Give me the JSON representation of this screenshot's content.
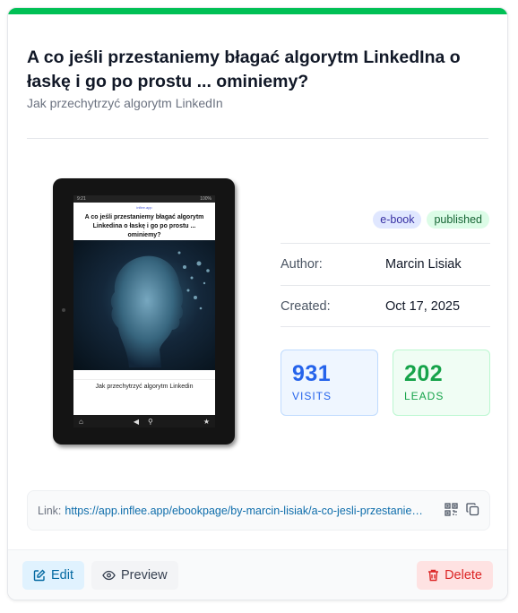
{
  "card": {
    "title": "A co jeśli przestaniemy błagać algorytm LinkedIna o łaskę i go po prostu ... ominiemy?",
    "subtitle": "Jak przechytrzyć algorytm LinkedIn",
    "accent_color": "#00c055"
  },
  "cover": {
    "status_time": "9:21",
    "status_battery": "100%",
    "logo_text": "inflee.app",
    "title": "A co jeśli przestaniemy błagać algorytm Linkedina o łaskę i go po prostu ... ominiemy?",
    "subtitle": "Jak przechytrzyć algorytm Linkedin",
    "nav_icons": [
      "home-icon",
      "back-icon",
      "search-icon",
      "star-icon"
    ]
  },
  "badges": {
    "type": "e-book",
    "status": "published"
  },
  "details": {
    "author_label": "Author:",
    "author_value": "Marcin Lisiak",
    "created_label": "Created:",
    "created_value": "Oct 17, 2025"
  },
  "stats": {
    "visits_value": "931",
    "visits_label": "VISITS",
    "leads_value": "202",
    "leads_label": "LEADS"
  },
  "link": {
    "label": "Link:",
    "url": "https://app.inflee.app/ebookpage/by-marcin-lisiak/a-co-jesli-przestaniemy-blagac-algorytm-linkedina",
    "icons": [
      "qr-code-icon",
      "copy-icon"
    ]
  },
  "actions": {
    "edit_label": "Edit",
    "preview_label": "Preview",
    "delete_label": "Delete"
  }
}
